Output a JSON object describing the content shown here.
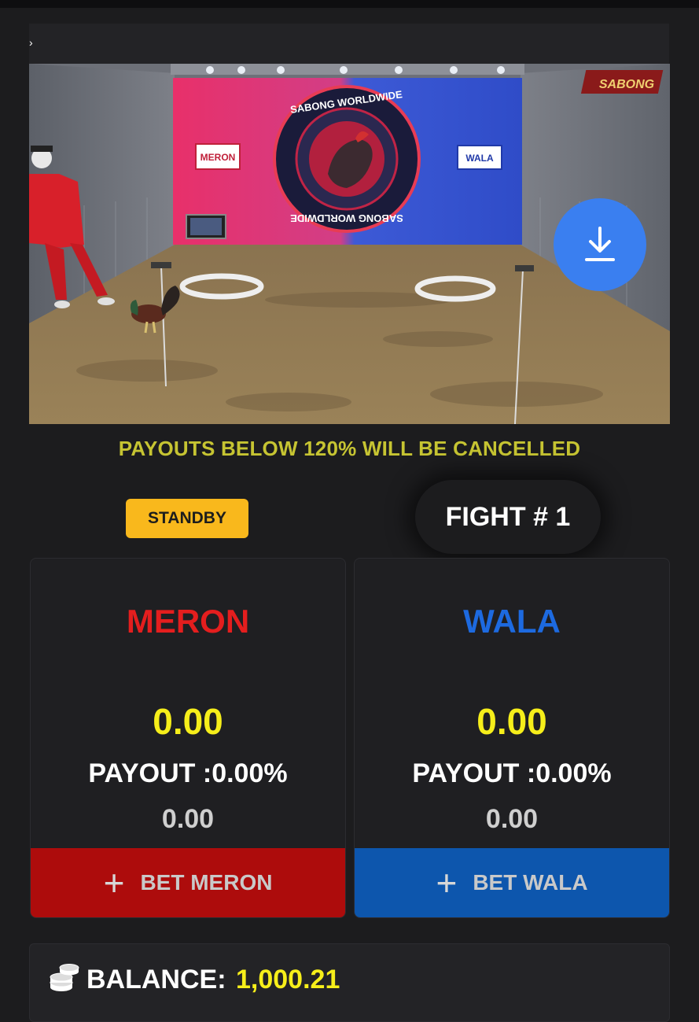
{
  "video": {
    "logo_text": "SABONG",
    "banner_left": "MERON",
    "banner_right": "WALA",
    "emblem_top": "SABONG WORLDWIDE",
    "emblem_bottom": "SABONG WORLDWIDE",
    "download_icon": "download-icon"
  },
  "notice": "PAYOUTS BELOW 120% WILL BE CANCELLED",
  "status": "STANDBY",
  "fight": "FIGHT # 1",
  "sides": {
    "meron": {
      "title": "MERON",
      "total": "0.00",
      "payout": "PAYOUT :0.00%",
      "my_bet": "0.00",
      "button_label": "BET MERON",
      "button_icon": "plus-icon",
      "color": "#e41e1e"
    },
    "wala": {
      "title": "WALA",
      "total": "0.00",
      "payout": "PAYOUT :0.00%",
      "my_bet": "0.00",
      "button_label": "BET WALA",
      "button_icon": "plus-icon",
      "color": "#1d6ae0"
    }
  },
  "balance": {
    "label": "BALANCE:",
    "value": "1,000.21",
    "icon": "coins-icon"
  }
}
